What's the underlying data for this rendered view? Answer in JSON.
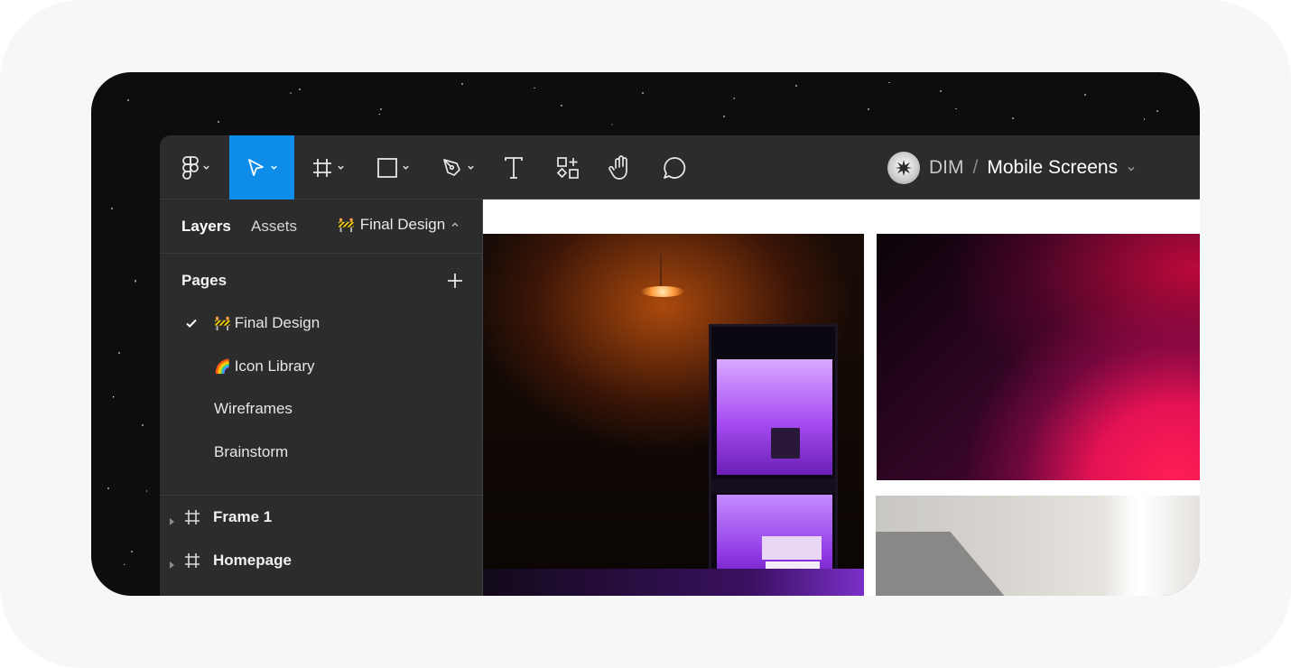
{
  "app": {
    "toolbar": {
      "tools": [
        {
          "name": "main-menu",
          "icon": "figma-logo-icon",
          "has_caret": true
        },
        {
          "name": "move",
          "icon": "pointer-arrow-icon",
          "has_caret": true,
          "active": true
        },
        {
          "name": "frame",
          "icon": "frame-hash-icon",
          "has_caret": true
        },
        {
          "name": "shape",
          "icon": "rectangle-icon",
          "has_caret": true
        },
        {
          "name": "pen",
          "icon": "pen-nib-icon",
          "has_caret": true
        },
        {
          "name": "text",
          "icon": "text-t-icon",
          "has_caret": false
        },
        {
          "name": "resources",
          "icon": "components-grid-icon",
          "has_caret": false
        },
        {
          "name": "hand",
          "icon": "hand-icon",
          "has_caret": false
        },
        {
          "name": "comment",
          "icon": "comment-bubble-icon",
          "has_caret": false
        }
      ],
      "active_color": "#0d8ce9"
    },
    "project": {
      "team": "DIM",
      "separator": "/",
      "name": "Mobile Screens"
    }
  },
  "left_panel": {
    "tabs": {
      "layers": "Layers",
      "assets": "Assets"
    },
    "current_page": {
      "emoji": "🚧",
      "label": "Final Design"
    },
    "pages_heading": "Pages",
    "pages": [
      {
        "emoji": "🚧",
        "label": "Final Design",
        "selected": true
      },
      {
        "emoji": "🌈",
        "label": "Icon Library",
        "selected": false
      },
      {
        "emoji": "",
        "label": "Wireframes",
        "selected": false
      },
      {
        "emoji": "",
        "label": "Brainstorm",
        "selected": false
      }
    ],
    "layers": [
      {
        "label": "Frame 1"
      },
      {
        "label": "Homepage"
      }
    ]
  },
  "colors": {
    "panel_bg": "#2c2c2c",
    "accent": "#0d8ce9",
    "canvas_bg": "#ffffff"
  }
}
